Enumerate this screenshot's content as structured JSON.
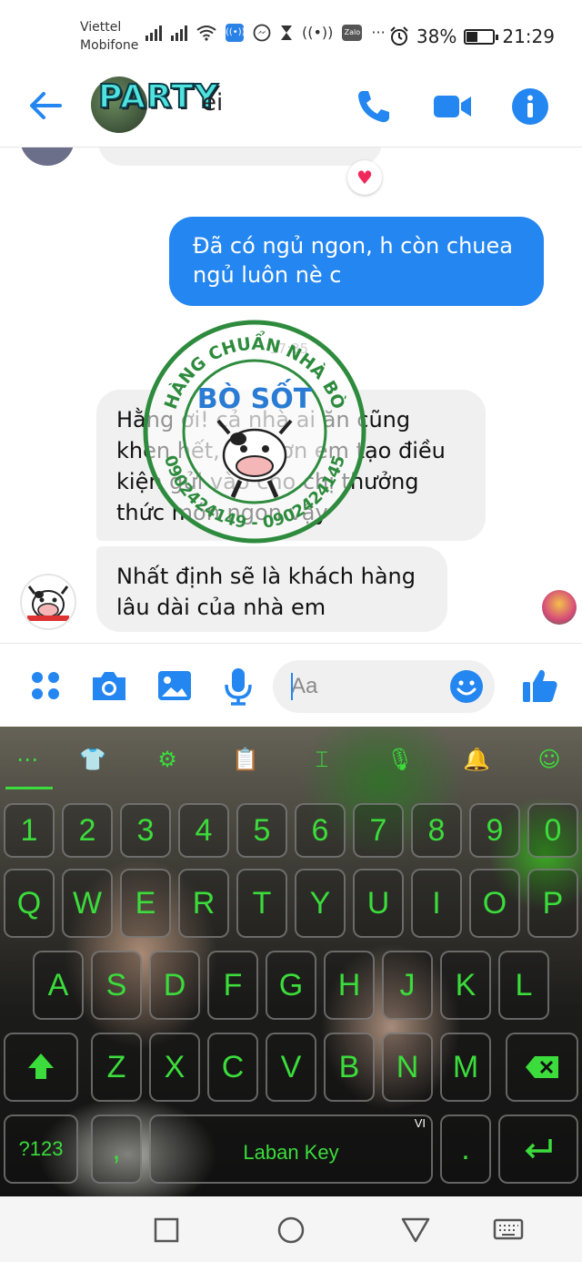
{
  "status_bar": {
    "carrier_1": "Viettel",
    "carrier_2": "Mobifone",
    "battery": "38%",
    "time": "21:29",
    "icons": [
      "signal-icon",
      "signal-icon",
      "wifi-icon",
      "wifi-calling-icon",
      "messenger-icon",
      "hourglass-icon",
      "hotspot-icon",
      "zalo-icon",
      "more-icon",
      "alarm-icon",
      "battery-icon"
    ],
    "zalo_label": "Zalo",
    "more_label": "···"
  },
  "header": {
    "title_art": "PARTY",
    "title_tail": "ei",
    "icons": [
      "back-arrow-icon",
      "phone-icon",
      "video-camera-icon",
      "info-icon"
    ]
  },
  "messages": {
    "reaction": "♥",
    "outgoing": "Đã có ngủ ngon, h còn chuea ngủ luôn nè c",
    "time": "17:35",
    "incoming": [
      "Hằng ơi! cả nhà ai ăn cũng khen hết, cám ơn em tạo điều kiện gửi vào cho chị thưởng thức món ngon vậy",
      "Nhất định sẽ là khách hàng lâu dài của nhà em"
    ]
  },
  "watermark": {
    "top_text": "HÀNG CHUẨN NHÀ BÒ",
    "center_text": "BÒ SỐT",
    "bottom_text": "0902424149 - 0902424145"
  },
  "composer": {
    "placeholder": "Aa",
    "icons": [
      "menu-dots-icon",
      "camera-icon",
      "gallery-icon",
      "microphone-icon",
      "emoji-icon",
      "thumbs-up-icon"
    ]
  },
  "keyboard": {
    "toolbar_icons": [
      "keyboard-menu-icon",
      "shirt-icon",
      "settings-icon",
      "clipboard-icon",
      "text-cursor-icon",
      "voice-icon",
      "notification-icon",
      "emoji-icon"
    ],
    "number_row": [
      "1",
      "2",
      "3",
      "4",
      "5",
      "6",
      "7",
      "8",
      "9",
      "0"
    ],
    "row1": [
      "Q",
      "W",
      "E",
      "R",
      "T",
      "Y",
      "U",
      "I",
      "O",
      "P"
    ],
    "row2": [
      "A",
      "S",
      "D",
      "F",
      "G",
      "H",
      "J",
      "K",
      "L"
    ],
    "row3": [
      "Z",
      "X",
      "C",
      "V",
      "B",
      "N",
      "M"
    ],
    "symbols_label": "?123",
    "comma_label": ",",
    "space_label": "Laban Key",
    "language_badge": "VI",
    "period_label": "."
  },
  "colors": {
    "messenger_blue": "#2486F0",
    "keyboard_green": "#3BDC3B",
    "stamp_green": "#2E8B3E",
    "stamp_blue": "#2A7BD3"
  }
}
